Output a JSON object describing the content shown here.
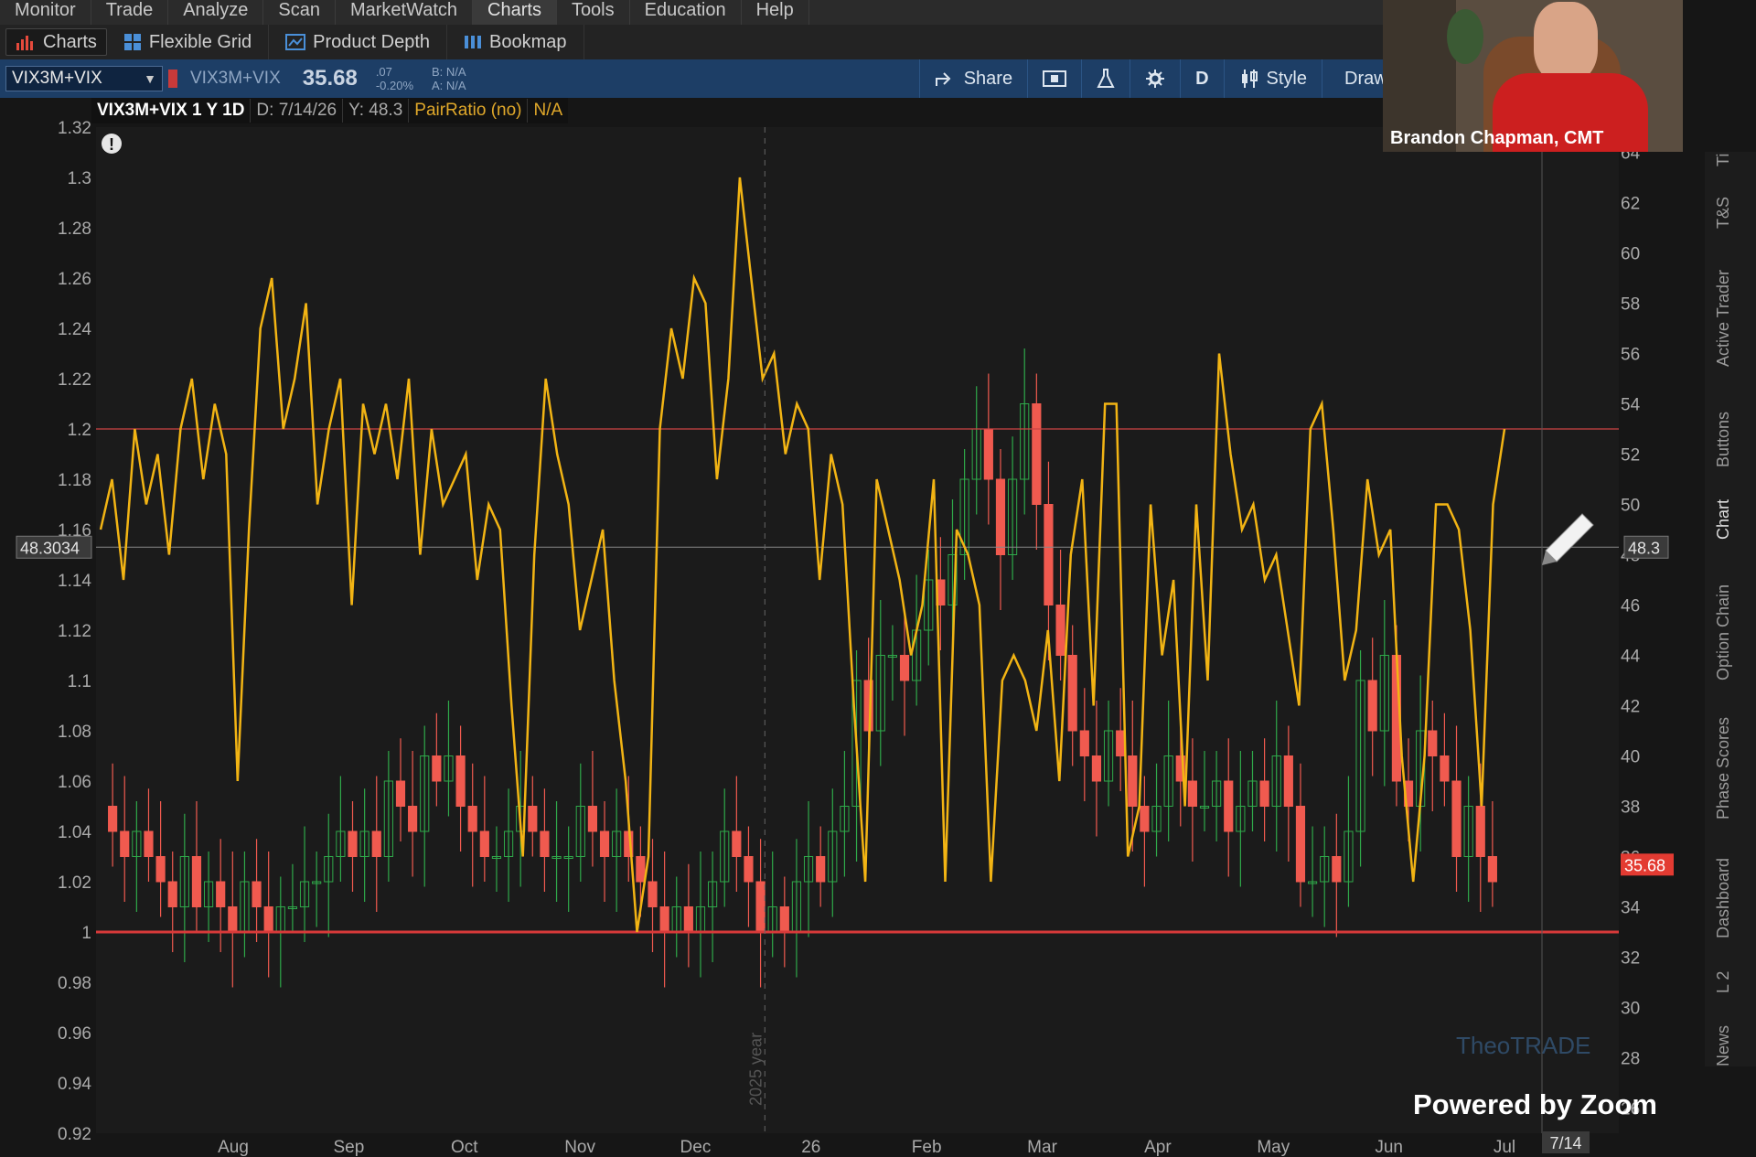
{
  "menu": [
    "Monitor",
    "Trade",
    "Analyze",
    "Scan",
    "MarketWatch",
    "Charts",
    "Tools",
    "Education",
    "Help"
  ],
  "menu_active": "Charts",
  "subtabs": {
    "charts": "Charts",
    "flexible_grid": "Flexible Grid",
    "product_depth": "Product Depth",
    "bookmap": "Bookmap"
  },
  "toolbar": {
    "symbol": "VIX3M+VIX",
    "symbol_label": "VIX3M+VIX",
    "last_price": "35.68",
    "change": ".07",
    "change_pct": "-0.20%",
    "bid": "B: N/A",
    "ask": "A: N/A",
    "share": "Share",
    "aggregation": "D",
    "style": "Style",
    "draw": "Draw"
  },
  "info_bar": {
    "symbol": "VIX3M+VIX 1 Y 1D",
    "date": "D: 7/14/26",
    "y": "Y: 48.3",
    "study": "PairRatio (no)",
    "study_value": "N/A"
  },
  "webcam": {
    "name": "Brandon Chapman, CMT"
  },
  "side_tabs": [
    "News",
    "L 2",
    "Dashboard",
    "Phase Scores",
    "Option Chain",
    "Chart",
    "Buttons",
    "Active Trader",
    "T&S",
    "Ti"
  ],
  "footer": {
    "zoom": "Powered by Zoom",
    "watermark": "TheoTRADE"
  },
  "colors": {
    "ratio_line": "#f2b414",
    "up": "#2fa94a",
    "down": "#f05a4f",
    "hline": "#d83a3a",
    "toolbar": "#1d3e66"
  },
  "chart_data": {
    "type": "line",
    "left_axis": {
      "ticks": [
        "1.32",
        "1.3",
        "1.28",
        "1.26",
        "1.24",
        "1.22",
        "1.2",
        "1.18",
        "1.16",
        "1.14",
        "1.12",
        "1.1",
        "1.08",
        "1.06",
        "1.04",
        "1.02",
        "1",
        "0.98",
        "0.96",
        "0.94",
        "0.92"
      ],
      "range": [
        0.92,
        1.32
      ]
    },
    "right_axis": {
      "ticks": [
        "64",
        "62",
        "60",
        "58",
        "56",
        "54",
        "52",
        "50",
        "48",
        "46",
        "44",
        "42",
        "40",
        "38",
        "36",
        "34",
        "32",
        "30",
        "28",
        "26"
      ],
      "range": [
        25,
        65
      ]
    },
    "x_labels": [
      "Aug",
      "Sep",
      "Oct",
      "Nov",
      "Dec",
      "26",
      "Feb",
      "Mar",
      "Apr",
      "May",
      "Jun",
      "Jul"
    ],
    "year_marker": "2025 year",
    "current_date": "7/14",
    "left_price_label": "48.3034",
    "right_price_label": "48.3",
    "right_last_label": "35.68",
    "horizontal_lines": [
      1.2,
      1.0,
      48.3
    ],
    "series": [
      {
        "name": "PairRatio",
        "values": [
          1.16,
          1.18,
          1.14,
          1.2,
          1.17,
          1.19,
          1.15,
          1.2,
          1.22,
          1.18,
          1.21,
          1.19,
          1.06,
          1.16,
          1.24,
          1.26,
          1.2,
          1.22,
          1.25,
          1.17,
          1.2,
          1.22,
          1.13,
          1.21,
          1.19,
          1.21,
          1.18,
          1.22,
          1.15,
          1.2,
          1.17,
          1.18,
          1.19,
          1.14,
          1.17,
          1.16,
          1.09,
          1.03,
          1.15,
          1.22,
          1.19,
          1.17,
          1.12,
          1.14,
          1.16,
          1.1,
          1.06,
          1.0,
          1.03,
          1.2,
          1.24,
          1.22,
          1.26,
          1.25,
          1.18,
          1.22,
          1.3,
          1.26,
          1.22,
          1.23,
          1.19,
          1.21,
          1.2,
          1.14,
          1.19,
          1.17,
          1.09,
          1.02,
          1.18,
          1.16,
          1.14,
          1.11,
          1.13,
          1.18,
          1.02,
          1.16,
          1.15,
          1.13,
          1.02,
          1.1,
          1.11,
          1.1,
          1.08,
          1.12,
          1.06,
          1.15,
          1.18,
          1.09,
          1.21,
          1.21,
          1.03,
          1.05,
          1.17,
          1.11,
          1.14,
          1.05,
          1.17,
          1.1,
          1.23,
          1.19,
          1.16,
          1.17,
          1.14,
          1.15,
          1.12,
          1.09,
          1.2,
          1.21,
          1.16,
          1.1,
          1.12,
          1.18,
          1.15,
          1.16,
          1.07,
          1.02,
          1.07,
          1.17,
          1.17,
          1.16,
          1.12,
          1.05,
          1.17,
          1.2
        ]
      },
      {
        "name": "VIX3M+VIX",
        "values": [
          38,
          37,
          36,
          37,
          36,
          35,
          34,
          36,
          34,
          35,
          34,
          33,
          35,
          34,
          33,
          34,
          34,
          35,
          35,
          36,
          37,
          36,
          37,
          36,
          39,
          38,
          37,
          40,
          39,
          40,
          38,
          37,
          36,
          36,
          37,
          38,
          37,
          36,
          36,
          36,
          38,
          37,
          36,
          37,
          36,
          35,
          34,
          33,
          34,
          33,
          34,
          35,
          37,
          36,
          35,
          33,
          34,
          33,
          35,
          36,
          35,
          37,
          38,
          43,
          41,
          44,
          44,
          43,
          45,
          47,
          46,
          48,
          51,
          53,
          51,
          48,
          51,
          54,
          50,
          46,
          44,
          41,
          40,
          39,
          41,
          40,
          38,
          37,
          38,
          40,
          39,
          38,
          38,
          39,
          37,
          38,
          39,
          38,
          40,
          38,
          35,
          35,
          36,
          35,
          37,
          43,
          41,
          44,
          39,
          38,
          41,
          40,
          39,
          36,
          38,
          36,
          35
        ]
      }
    ]
  }
}
